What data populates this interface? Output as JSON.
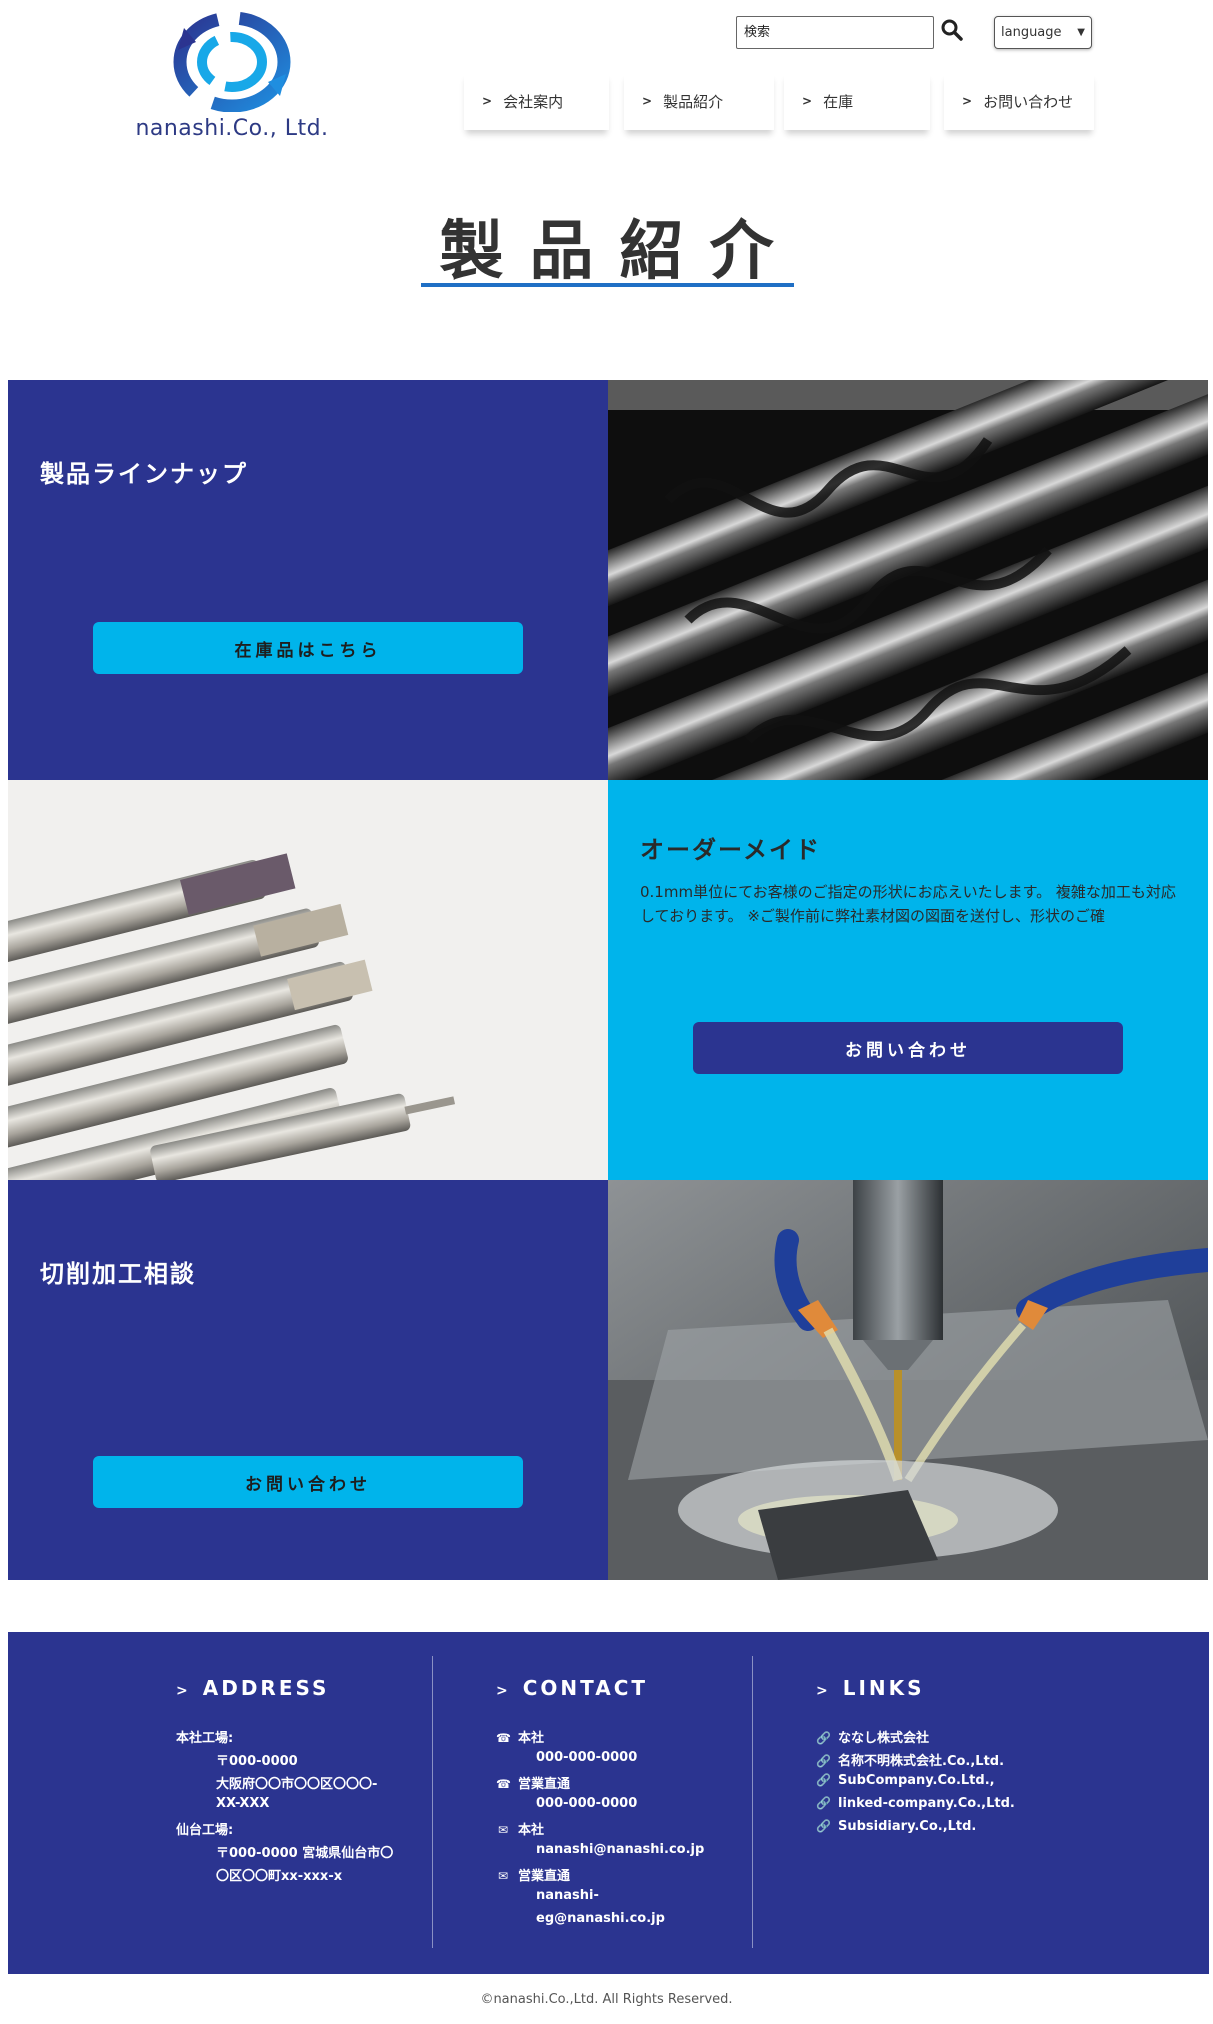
{
  "header": {
    "logo_text": "nanashi.Co., Ltd.",
    "search": {
      "placeholder": "検索"
    },
    "language_label": "language"
  },
  "nav": [
    {
      "label": "会社案内"
    },
    {
      "label": "製品紹介"
    },
    {
      "label": "在庫"
    },
    {
      "label": "お問い合わせ"
    }
  ],
  "page_title": "製品紹介",
  "blocks": {
    "lineup": {
      "title": "製品ラインナップ",
      "button": "在庫品はこちら"
    },
    "ordermade": {
      "title": "オーダーメイド",
      "description": "0.1mm単位にてお客様のご指定の形状にお応えいたします。 複雑な加工も対応しております。 ※ご製作前に弊社素材図の図面を送付し、形状のご確",
      "button": "お問い合わせ"
    },
    "cutting": {
      "title": "切削加工相談",
      "button": "お問い合わせ"
    }
  },
  "footer": {
    "address": {
      "heading": "ADDRESS",
      "lines": [
        "本社工場:",
        "〒000-0000",
        "大阪府〇〇市〇〇区〇〇〇-",
        "XX-XXX",
        "仙台工場:",
        "〒000-0000 宮城県仙台市〇",
        "〇区〇〇町xx-xxx-x"
      ]
    },
    "contact": {
      "heading": "CONTACT",
      "items": [
        {
          "icon": "phone-icon",
          "label": "本社",
          "value": "000-000-0000"
        },
        {
          "icon": "phone-icon",
          "label": "営業直通",
          "value": "000-000-0000"
        },
        {
          "icon": "mail-icon",
          "label": "本社",
          "value": "nanashi@nanashi.co.jp"
        },
        {
          "icon": "mail-icon",
          "label": "営業直通",
          "value": "nanashi-",
          "value2": "eg@nanashi.co.jp"
        }
      ]
    },
    "links": {
      "heading": "LINKS",
      "items": [
        "ななし株式会社",
        "名称不明株式会社.Co.,Ltd.",
        "SubCompany.Co.Ltd.,",
        "linked-company.Co.,Ltd.",
        "Subsidiary.Co.,Ltd."
      ]
    }
  },
  "copyright": "©nanashi.Co.,Ltd. All Rights Reserved.",
  "colors": {
    "navy": "#2b3490",
    "cyan": "#00b4eb",
    "underline": "#1f6fc5"
  }
}
